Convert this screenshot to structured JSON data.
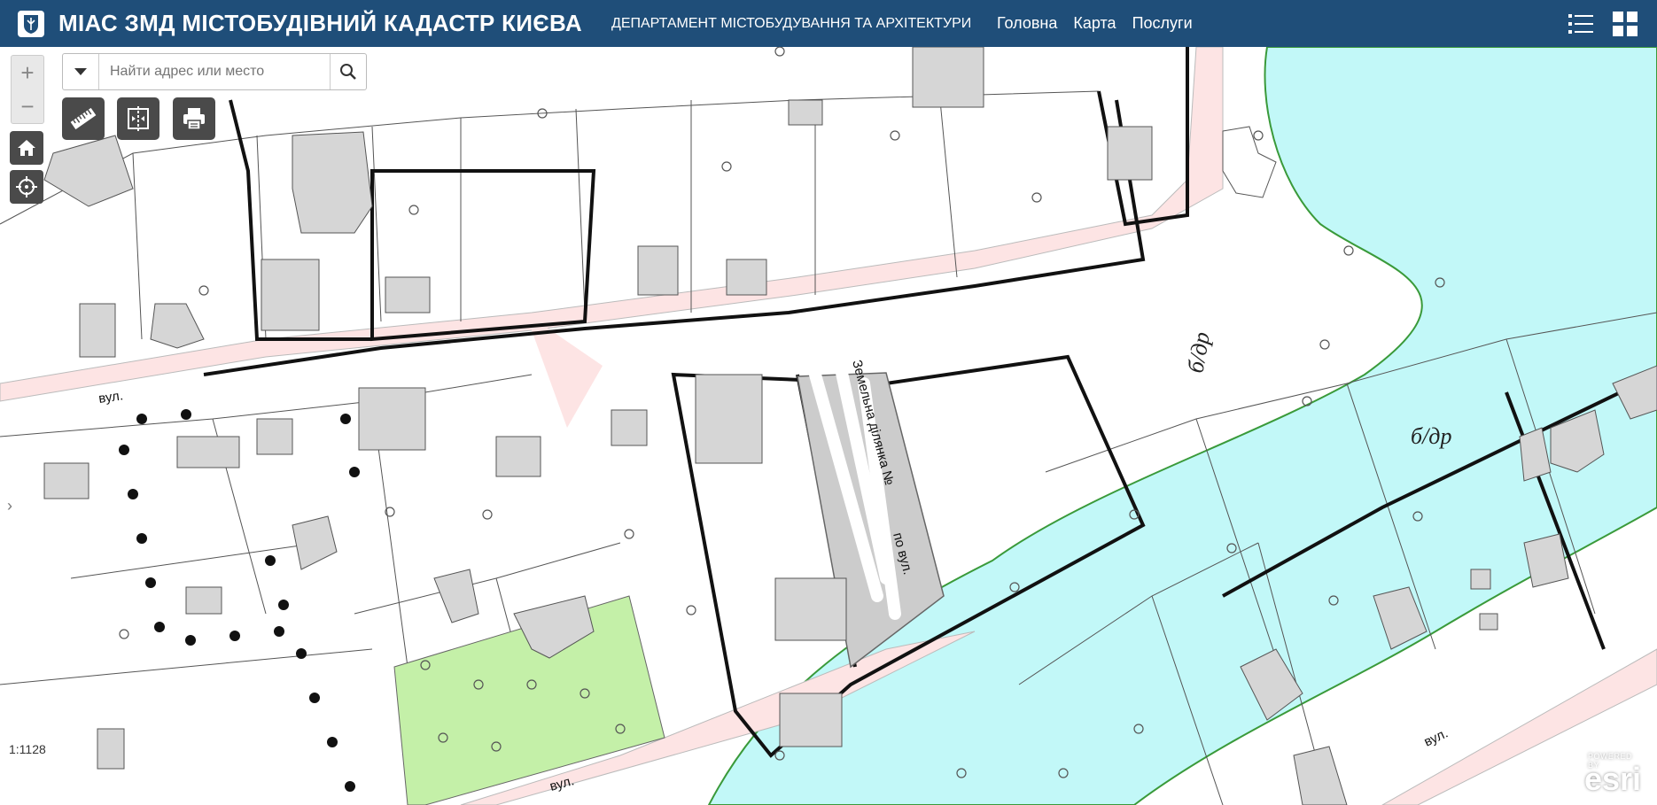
{
  "header": {
    "title": "МІАС ЗМД МІСТОБУДІВНИЙ КАДАСТР КИЄВА",
    "department": "ДЕПАРТАМЕНТ МІСТОБУДУВАННЯ ТА АРХІТЕКТУРИ",
    "nav": [
      "Головна",
      "Карта",
      "Послуги"
    ]
  },
  "search": {
    "placeholder": "Найти адрес или место"
  },
  "zoom": {
    "in": "+",
    "out": "−"
  },
  "map": {
    "scale": "1:1128",
    "parcel_label": "Земельна ділянка №",
    "parcel_street": "по вул.",
    "street_labels": [
      "вул.",
      "вул.",
      "вул."
    ],
    "zone_labels": [
      "б/др",
      "б/др"
    ],
    "colors": {
      "water": "#c2f8f8",
      "road": "#fde4e4",
      "green_zone": "#c4f0a8",
      "parcel": "#cccccc",
      "building": "#d6d6d6"
    }
  },
  "branding": {
    "powered_by": "POWERED BY",
    "esri": "esri"
  }
}
